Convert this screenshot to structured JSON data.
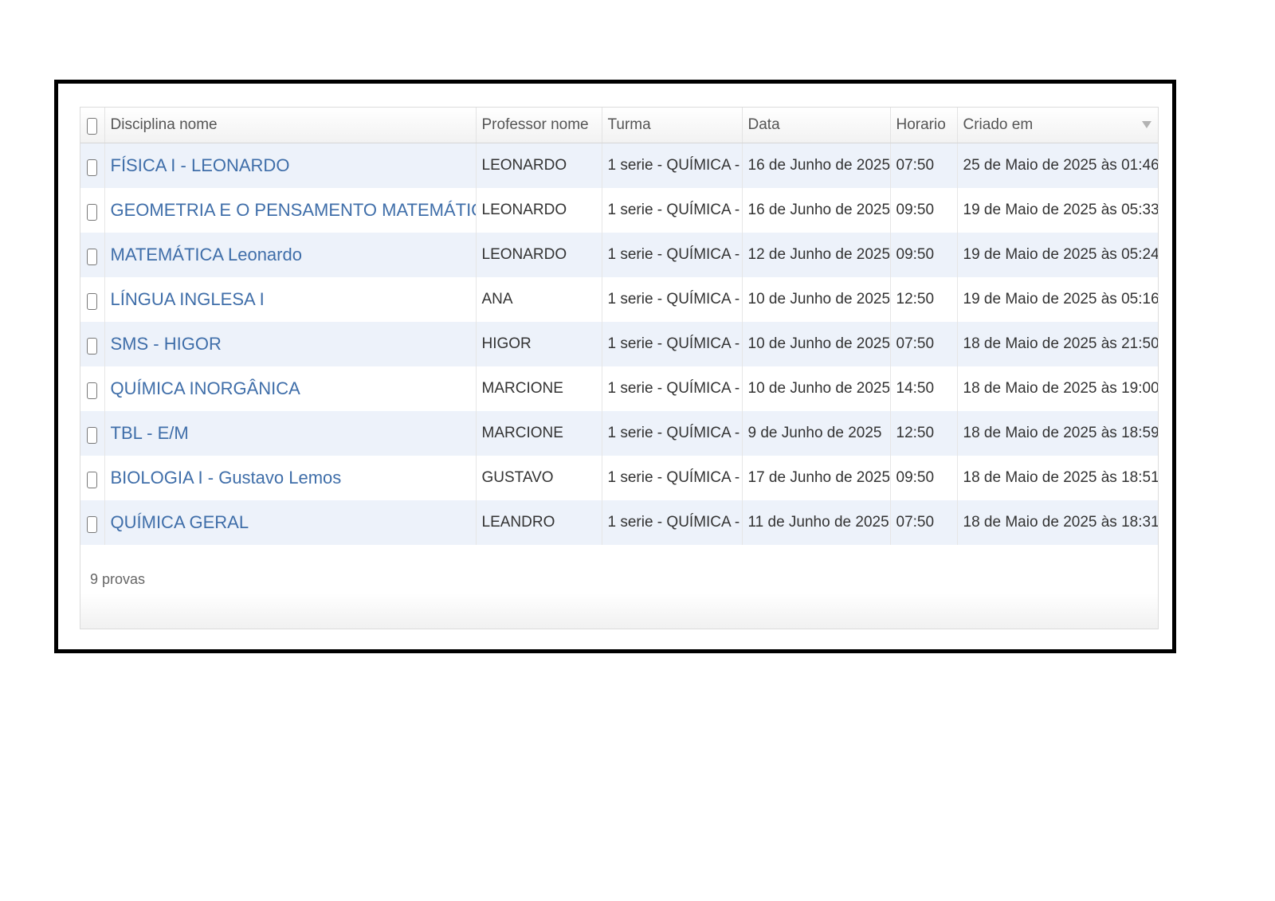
{
  "grid": {
    "columns": {
      "disciplina": "Disciplina nome",
      "professor": "Professor nome",
      "turma": "Turma",
      "data": "Data",
      "horario": "Horario",
      "criado": "Criado em"
    },
    "rows": [
      {
        "disciplina": "FÍSICA I - LEONARDO",
        "professor": "LEONARDO",
        "turma": "1 serie - QUÍMICA -",
        "data": "16 de Junho de 2025",
        "horario": "07:50",
        "criado": "25 de Maio de 2025 às 01:46"
      },
      {
        "disciplina": "GEOMETRIA E O PENSAMENTO MATEMÁTICO",
        "professor": "LEONARDO",
        "turma": "1 serie - QUÍMICA -",
        "data": "16 de Junho de 2025",
        "horario": "09:50",
        "criado": "19 de Maio de 2025 às 05:33"
      },
      {
        "disciplina": "MATEMÁTICA Leonardo",
        "professor": "LEONARDO",
        "turma": "1 serie - QUÍMICA -",
        "data": "12 de Junho de 2025",
        "horario": "09:50",
        "criado": "19 de Maio de 2025 às 05:24"
      },
      {
        "disciplina": "LÍNGUA INGLESA I",
        "professor": "ANA",
        "turma": "1 serie - QUÍMICA -",
        "data": "10 de Junho de 2025",
        "horario": "12:50",
        "criado": "19 de Maio de 2025 às 05:16"
      },
      {
        "disciplina": "SMS - HIGOR",
        "professor": "HIGOR",
        "turma": "1 serie - QUÍMICA -",
        "data": "10 de Junho de 2025",
        "horario": "07:50",
        "criado": "18 de Maio de 2025 às 21:50"
      },
      {
        "disciplina": "QUÍMICA INORGÂNICA",
        "professor": "MARCIONE",
        "turma": "1 serie - QUÍMICA -",
        "data": "10 de Junho de 2025",
        "horario": "14:50",
        "criado": "18 de Maio de 2025 às 19:00"
      },
      {
        "disciplina": "TBL - E/M",
        "professor": "MARCIONE",
        "turma": "1 serie - QUÍMICA -",
        "data": "9 de Junho de 2025",
        "horario": "12:50",
        "criado": "18 de Maio de 2025 às 18:59"
      },
      {
        "disciplina": "BIOLOGIA I - Gustavo Lemos",
        "professor": "GUSTAVO",
        "turma": "1 serie - QUÍMICA -",
        "data": "17 de Junho de 2025",
        "horario": "09:50",
        "criado": "18 de Maio de 2025 às 18:51"
      },
      {
        "disciplina": "QUÍMICA GERAL",
        "professor": "LEANDRO",
        "turma": "1 serie - QUÍMICA -",
        "data": "11 de Junho de 2025",
        "horario": "07:50",
        "criado": "18 de Maio de 2025 às 18:31"
      }
    ],
    "footer": "9 provas",
    "sort_icon": "triangle-down-icon"
  },
  "colors": {
    "link": "#3f6ea9",
    "row_alt": "#edf2fa",
    "frame_border": "#000000"
  }
}
